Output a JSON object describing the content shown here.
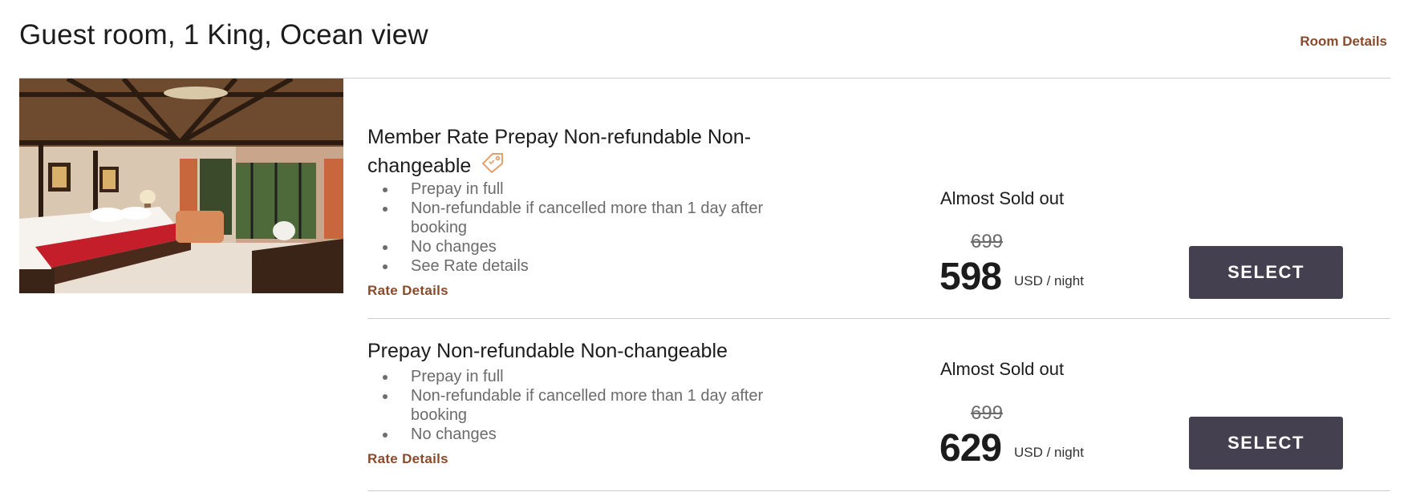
{
  "room": {
    "title": "Guest room, 1 King, Ocean view",
    "details_link": "Room Details"
  },
  "rates": [
    {
      "name": "Member Rate Prepay Non-refundable Non-changeable",
      "has_member_tag": true,
      "features": [
        "Prepay in full",
        "Non-refundable if cancelled more than 1 day after booking",
        "No changes",
        "See Rate details"
      ],
      "details_link": "Rate Details",
      "availability": "Almost Sold out",
      "original_price": "699",
      "price": "598",
      "unit": "USD / night",
      "button_label": "SELECT"
    },
    {
      "name": "Prepay Non-refundable Non-changeable",
      "has_member_tag": false,
      "features": [
        "Prepay in full",
        "Non-refundable if cancelled more than 1 day after booking",
        "No changes"
      ],
      "details_link": "Rate Details",
      "availability": "Almost Sold out",
      "original_price": "699",
      "price": "629",
      "unit": "USD / night",
      "button_label": "SELECT"
    }
  ],
  "icons": {
    "gallery": "gallery-icon",
    "member_tag": "tag-icon"
  },
  "colors": {
    "accent": "#8a4b2c",
    "button": "#44404f",
    "tag": "#e5a06b"
  }
}
